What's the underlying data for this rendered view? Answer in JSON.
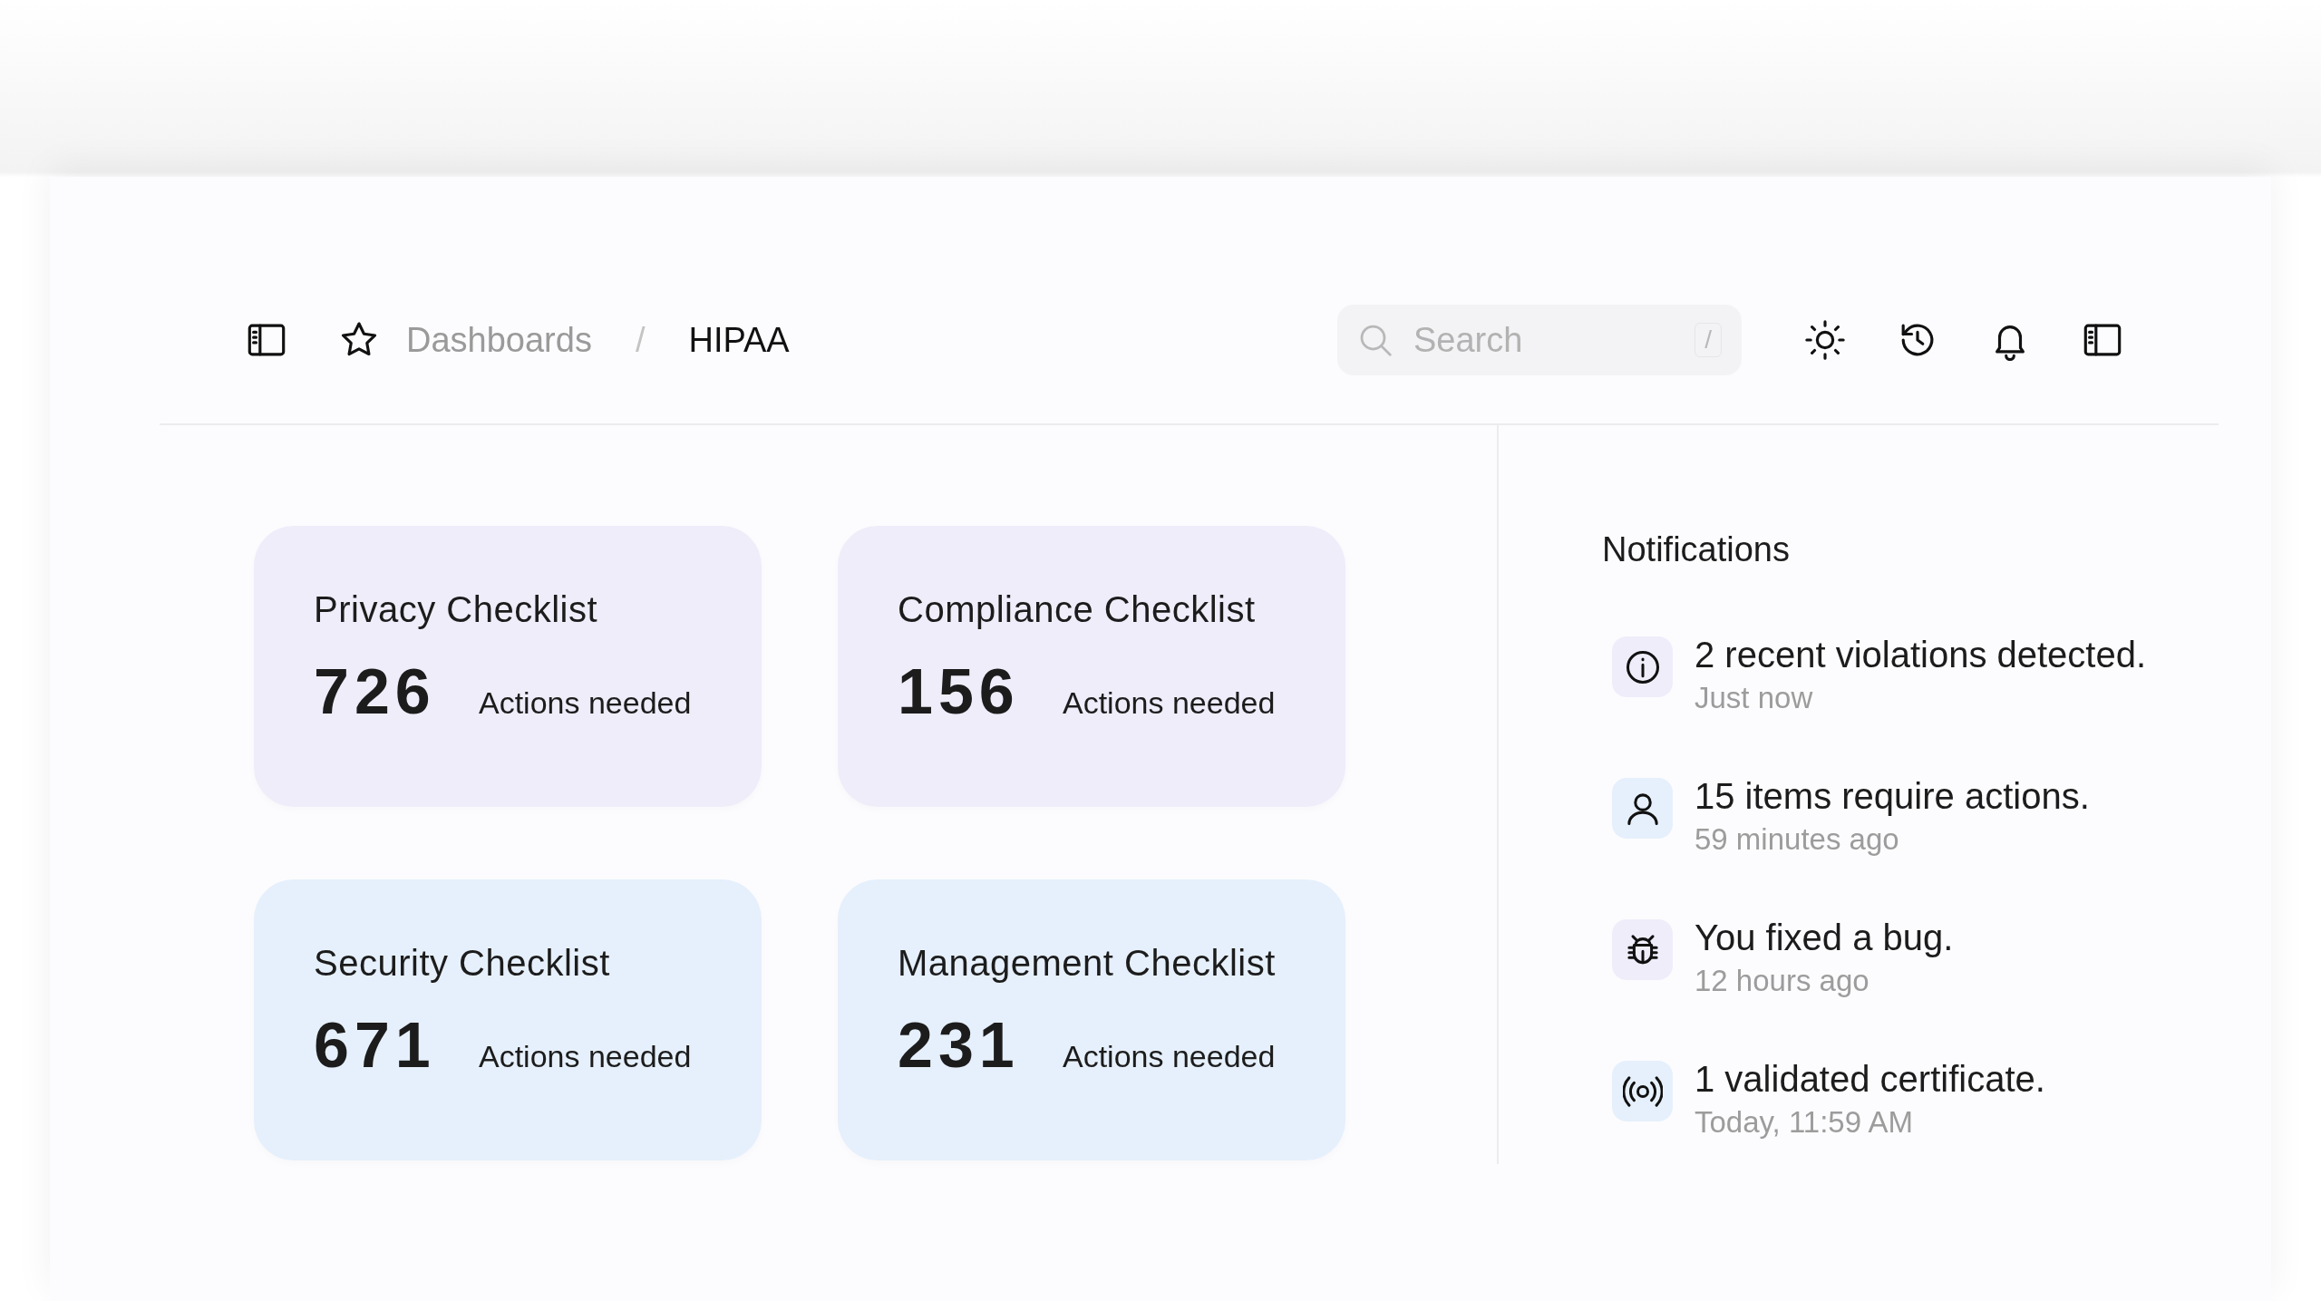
{
  "breadcrumbs": {
    "separator": "/",
    "items": [
      {
        "label": "Dashboards",
        "current": false
      },
      {
        "label": "HIPAA",
        "current": true
      }
    ]
  },
  "search": {
    "placeholder": "Search",
    "shortcut": "/"
  },
  "cards": [
    {
      "title": "Privacy Checklist",
      "count": "726",
      "caption": "Actions needed",
      "color": "#efedfa"
    },
    {
      "title": "Compliance Checklist",
      "count": "156",
      "caption": "Actions needed",
      "color": "#efedfa"
    },
    {
      "title": "Security Checklist",
      "count": "671",
      "caption": "Actions needed",
      "color": "#e6f0fc"
    },
    {
      "title": "Management Checklist",
      "count": "231",
      "caption": "Actions needed",
      "color": "#e6f0fc"
    }
  ],
  "notifications": {
    "title": "Notifications",
    "items": [
      {
        "kind": "info",
        "text": "2 recent violations detected.",
        "time": "Just now",
        "color": "#efedfa"
      },
      {
        "kind": "user",
        "text": "15 items require actions.",
        "time": "59 minutes ago",
        "color": "#e6f0fc"
      },
      {
        "kind": "bug",
        "text": "You fixed a bug.",
        "time": "12 hours ago",
        "color": "#efedfa"
      },
      {
        "kind": "signal",
        "text": "1 validated certificate.",
        "time": "Today, 11:59 AM",
        "color": "#e6f0fc"
      }
    ]
  }
}
